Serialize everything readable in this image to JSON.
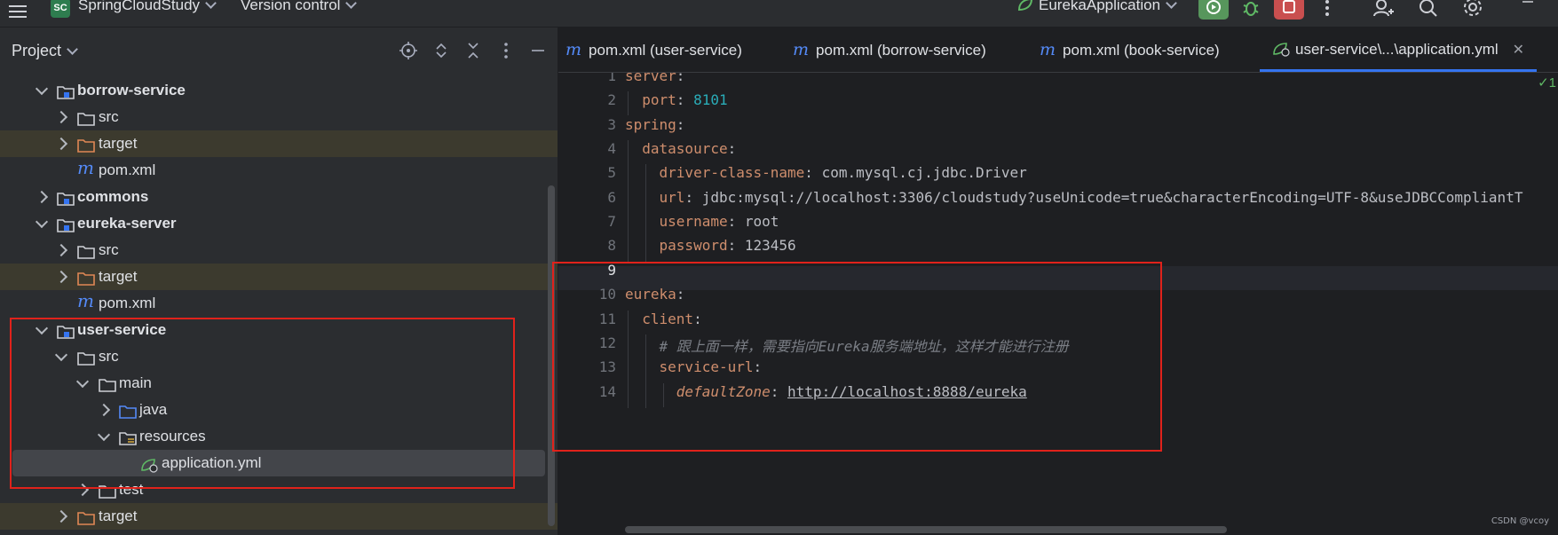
{
  "topbar": {
    "project_badge": "SC",
    "project_name": "SpringCloudStudy",
    "vcs_label": "Version control",
    "run_config": "EurekaApplication",
    "icons": [
      "menu-icon",
      "run-icon",
      "debug-icon",
      "stop-icon",
      "more-icon",
      "add-user-icon",
      "search-icon",
      "settings-icon",
      "minimize-icon"
    ]
  },
  "project_panel": {
    "title": "Project",
    "tree": [
      {
        "label": "borrow-service",
        "kind": "module",
        "expanded": true
      },
      {
        "label": "src",
        "kind": "folder"
      },
      {
        "label": "target",
        "kind": "excluded-folder"
      },
      {
        "label": "pom.xml",
        "kind": "maven-file"
      },
      {
        "label": "commons",
        "kind": "module"
      },
      {
        "label": "eureka-server",
        "kind": "module",
        "expanded": true
      },
      {
        "label": "src",
        "kind": "folder"
      },
      {
        "label": "target",
        "kind": "excluded-folder"
      },
      {
        "label": "pom.xml",
        "kind": "maven-file"
      },
      {
        "label": "user-service",
        "kind": "module",
        "expanded": true
      },
      {
        "label": "src",
        "kind": "folder",
        "expanded": true
      },
      {
        "label": "main",
        "kind": "folder",
        "expanded": true
      },
      {
        "label": "java",
        "kind": "source-folder"
      },
      {
        "label": "resources",
        "kind": "resources-folder",
        "expanded": true
      },
      {
        "label": "application.yml",
        "kind": "spring-yml",
        "selected": true
      },
      {
        "label": "test",
        "kind": "folder"
      },
      {
        "label": "target",
        "kind": "excluded-folder"
      }
    ]
  },
  "tabs": [
    {
      "label": "pom.xml (user-service)",
      "icon": "m"
    },
    {
      "label": "pom.xml (borrow-service)",
      "icon": "m"
    },
    {
      "label": "pom.xml (book-service)",
      "icon": "m"
    },
    {
      "label": "user-service\\...\\application.yml",
      "icon": "spring",
      "active": true
    }
  ],
  "editor": {
    "current_line": 9,
    "inspection_count": "1",
    "lines": [
      {
        "n": "1",
        "key": "server",
        "rest": ""
      },
      {
        "n": "2",
        "key": "  port",
        "rest": "8101"
      },
      {
        "n": "3",
        "key": "spring",
        "rest": ""
      },
      {
        "n": "4",
        "key": "  datasource",
        "rest": ""
      },
      {
        "n": "5",
        "key": "    driver-class-name",
        "rest": "com.mysql.cj.jdbc.Driver"
      },
      {
        "n": "6",
        "key": "    url",
        "rest": "jdbc:mysql://localhost:3306/cloudstudy?useUnicode=true&characterEncoding=UTF-8&useJDBCCompliantT"
      },
      {
        "n": "7",
        "key": "    username",
        "rest": "root"
      },
      {
        "n": "8",
        "key": "    password",
        "rest": "123456"
      },
      {
        "n": "9",
        "key": "",
        "rest": ""
      },
      {
        "n": "10",
        "key": "eureka",
        "rest": ""
      },
      {
        "n": "11",
        "key": "  client",
        "rest": ""
      },
      {
        "n": "12",
        "comment": "    # 跟上面一样，需要指向Eureka服务端地址，这样才能进行注册"
      },
      {
        "n": "13",
        "key": "    service-url",
        "rest": ""
      },
      {
        "n": "14",
        "key": "      defaultZone",
        "rest": "http://localhost:8888/eureka"
      }
    ]
  },
  "watermark": "CSDN @vcoy",
  "colors": {
    "highlight": "#e0221b",
    "accent": "#3574f0",
    "bg": "#1e1f22",
    "panel": "#2b2d30"
  }
}
